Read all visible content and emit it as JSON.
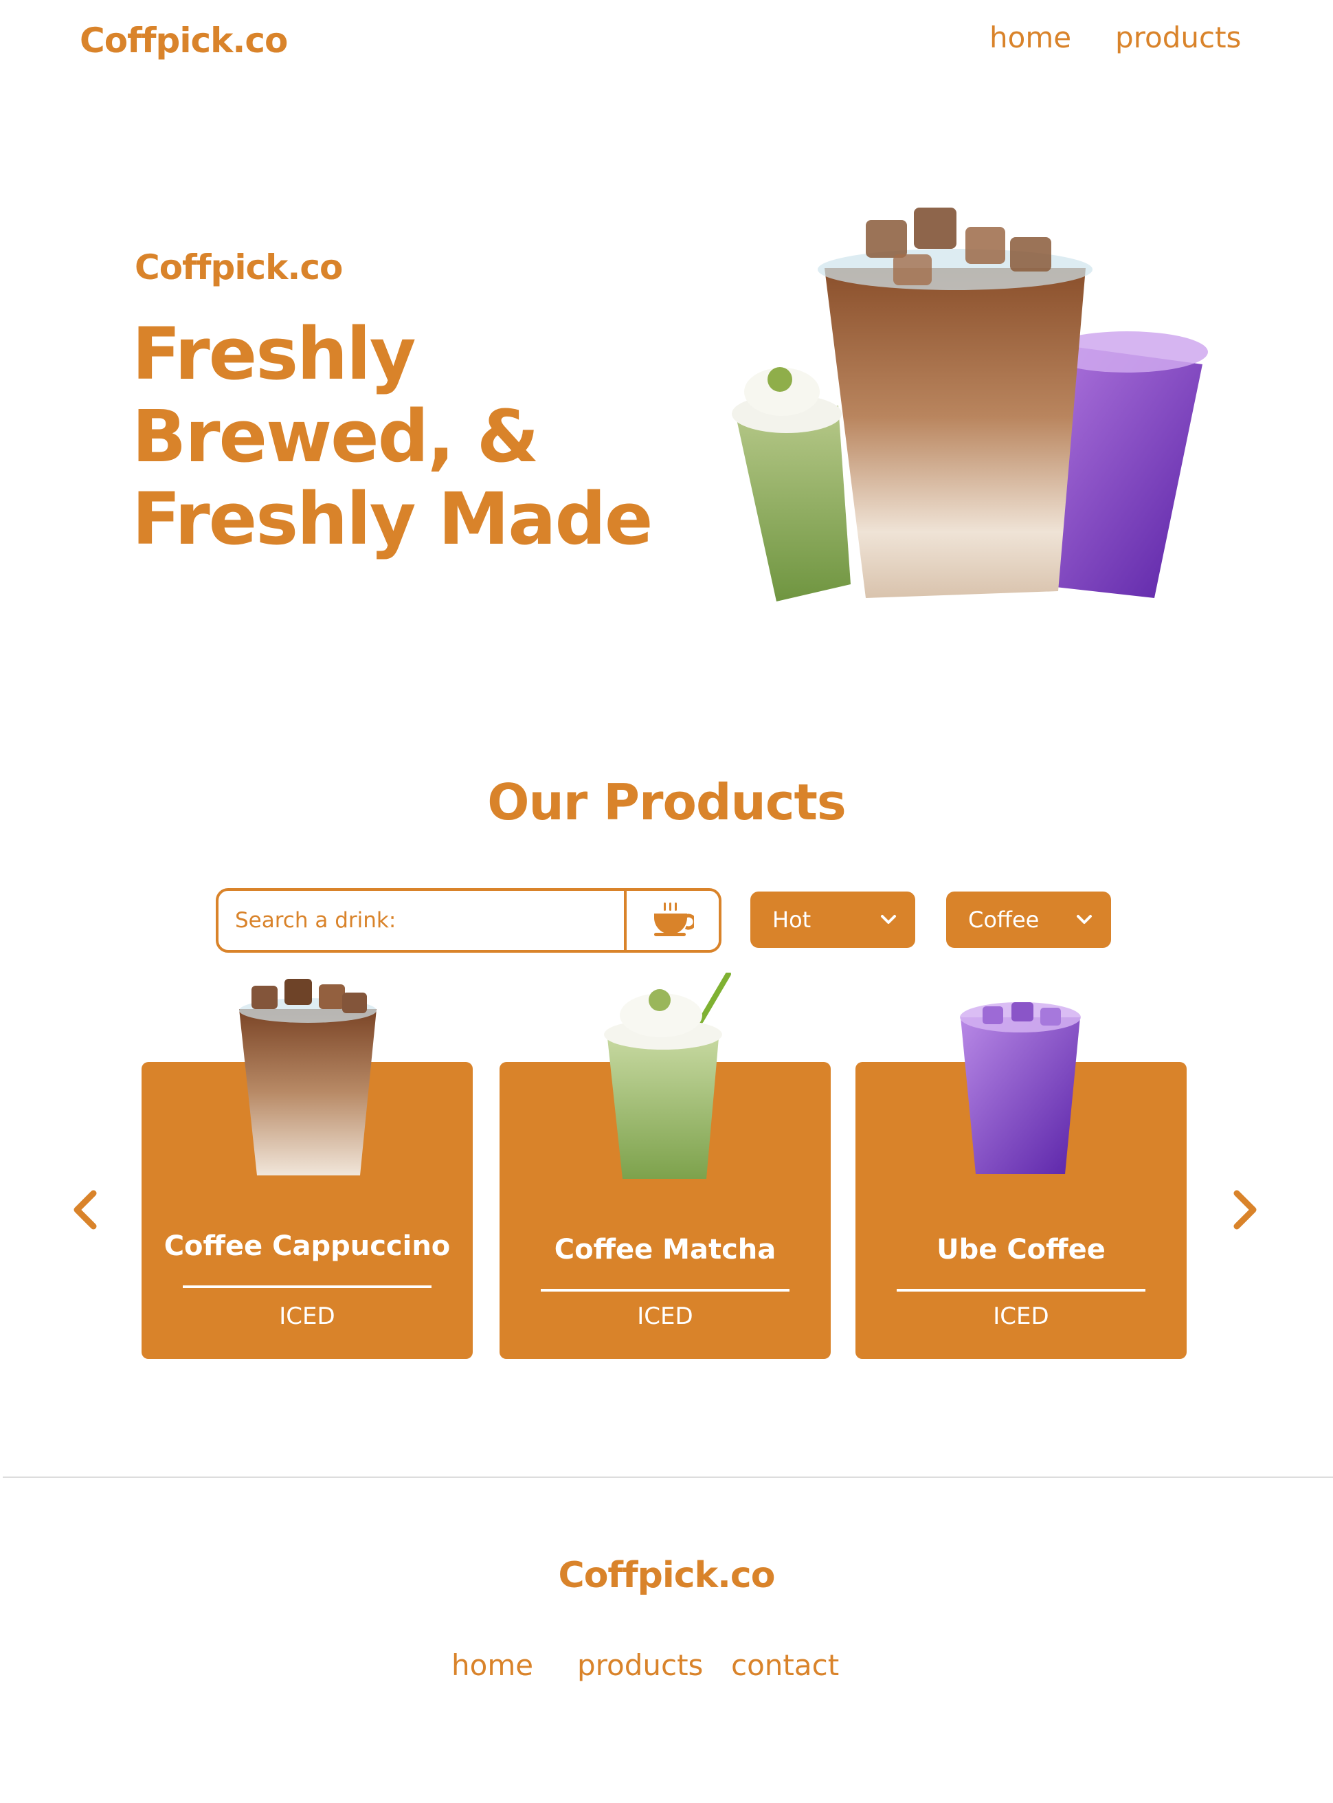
{
  "header": {
    "logo": "Coffpick.co",
    "nav": {
      "home": "home",
      "products": "products"
    }
  },
  "hero": {
    "brand": "Coffpick.co",
    "title": "Freshly Brewed, & Freshly Made"
  },
  "products": {
    "title": "Our Products",
    "search_placeholder": "Search a drink:",
    "filter_temperature": "Hot",
    "filter_type": "Coffee",
    "items": [
      {
        "name": "Coffee Cappuccino",
        "tag": "ICED"
      },
      {
        "name": "Coffee Matcha",
        "tag": "ICED"
      },
      {
        "name": "Ube Coffee",
        "tag": "ICED"
      }
    ]
  },
  "footer": {
    "logo": "Coffpick.co",
    "links": {
      "home": "home",
      "products": "products",
      "contact": "contact"
    }
  },
  "colors": {
    "accent": "#d9832a",
    "background": "#ffffff",
    "card_text": "#ffffff"
  },
  "icons": {
    "search_button": "coffee-cup-icon",
    "prev": "chevron-left-icon",
    "next": "chevron-right-icon",
    "dropdown": "chevron-down-icon"
  }
}
